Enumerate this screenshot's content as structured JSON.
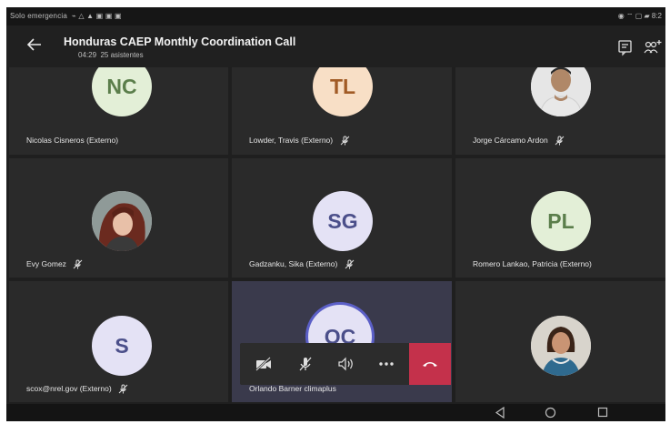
{
  "statusbar": {
    "left_text": "Solo emergencia",
    "right_text": "8:2"
  },
  "header": {
    "title": "Honduras CAEP Monthly Coordination Call",
    "duration": "04:29",
    "attendees": "25 asistentes"
  },
  "participants": [
    {
      "name": "Nicolas Cisneros (Externo)",
      "initials": "NC",
      "muted": false
    },
    {
      "name": "Lowder, Travis (Externo)",
      "initials": "TL",
      "muted": true
    },
    {
      "name": "Jorge Cárcamo Ardon",
      "initials": "",
      "muted": true
    },
    {
      "name": "Evy Gomez",
      "initials": "",
      "muted": true
    },
    {
      "name": "Gadzanku, Sika (Externo)",
      "initials": "SG",
      "muted": true
    },
    {
      "name": "Romero Lankao, Patricia (Externo)",
      "initials": "PL",
      "muted": false
    },
    {
      "name": "scox@nrel.gov (Externo)",
      "initials": "S",
      "muted": true
    },
    {
      "name": "Orlando Barner climaplus",
      "initials": "OC",
      "muted": false
    },
    {
      "name": "",
      "initials": "",
      "muted": false
    }
  ],
  "colors": {
    "hangup": "#c4314b",
    "tile": "#2a2a2a",
    "active_tile": "#3a3a4c"
  },
  "icons": {
    "back": "arrow-left-icon",
    "chat": "chat-icon",
    "participants": "add-people-icon",
    "camera": "camera-off-icon",
    "mic": "mic-off-icon",
    "speaker": "speaker-icon",
    "more": "more-icon",
    "hangup": "hang-up-icon"
  }
}
